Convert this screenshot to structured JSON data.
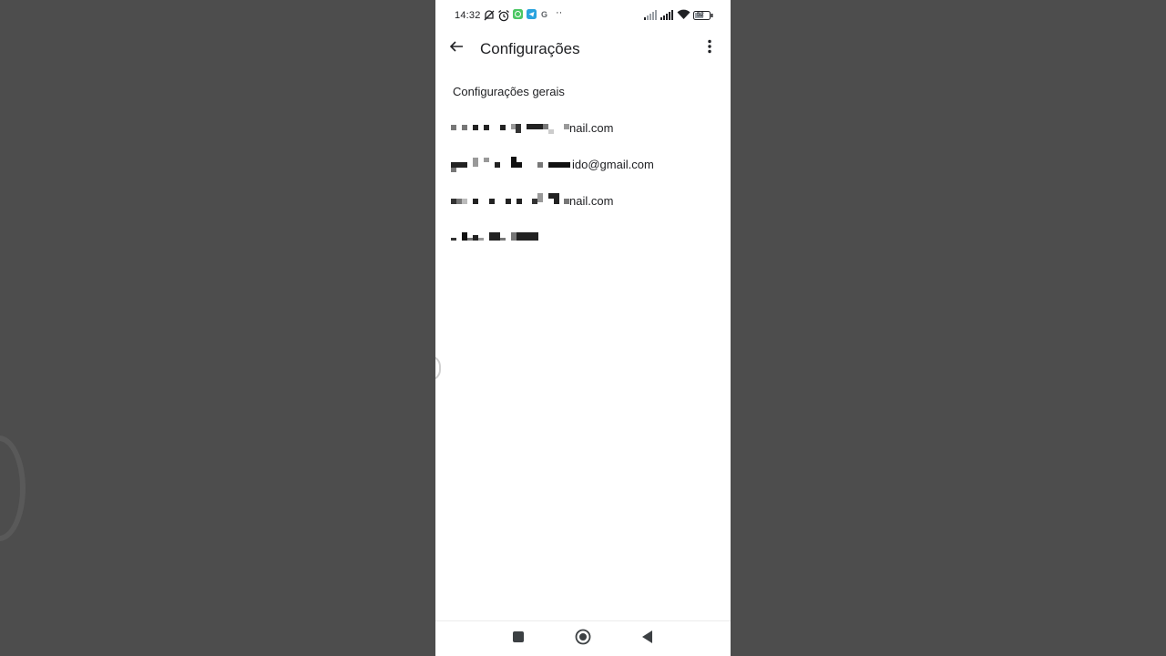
{
  "status_bar": {
    "time": "14:32",
    "left_icons": [
      "no-alarm-icon",
      "alarm-clock-icon",
      "whatsapp-icon",
      "telegram-icon",
      "google-icon",
      "more-notifications-icon"
    ],
    "right_icons": [
      "signal-1-icon",
      "signal-2-icon",
      "wifi-icon",
      "battery-icon"
    ],
    "battery_level": "52",
    "colors": {
      "whatsapp": "#4cc764",
      "telegram": "#2aa3de"
    }
  },
  "app_bar": {
    "title": "Configurações",
    "back_icon": "arrow-back-icon",
    "menu_icon": "more-vert-icon"
  },
  "section": {
    "label": "Configurações gerais"
  },
  "accounts": [
    {
      "visible_suffix": "nail.com"
    },
    {
      "visible_suffix": "ido@gmail.com"
    },
    {
      "visible_suffix": "nail.com"
    },
    {
      "visible_suffix": ""
    }
  ],
  "nav_bar": {
    "buttons": [
      "recents-square-icon",
      "home-circle-icon",
      "back-triangle-icon"
    ]
  }
}
